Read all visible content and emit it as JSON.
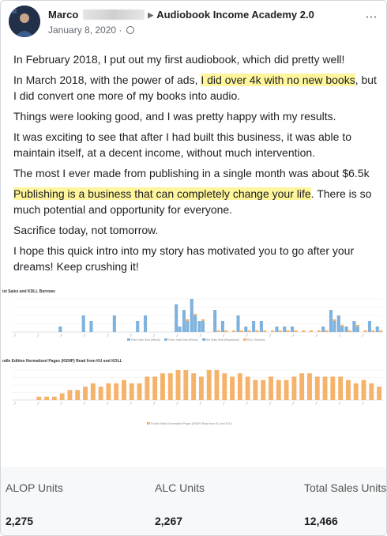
{
  "post": {
    "author": "Marco",
    "group": "Audiobook Income Academy 2.0",
    "date": "January 8, 2020",
    "separator": "·",
    "more_icon": "more-horizontal-icon",
    "privacy_icon": "globe-icon"
  },
  "paragraphs": [
    {
      "text": "In February 2018, I put out my first audiobook, which did pretty well!"
    },
    {
      "pre": "In March 2018, with the power of ads, ",
      "hl": "I did over 4k with no new books",
      "post": ", but I did convert one more of my books into audio."
    },
    {
      "text": "Things were looking good, and I was pretty happy with my results."
    },
    {
      "text": "It was exciting to see that after I had built this business, it was able to maintain itself, at a decent income, without much intervention."
    },
    {
      "text": "The most I ever made from publishing in a single month was about $6.5k"
    },
    {
      "pre": "",
      "hl": "Publishing is a business that can completely change your life",
      "post": ". There is so much potential and opportunity for everyone."
    },
    {
      "text": "Sacrifice today, not tomorrow."
    },
    {
      "text": "I hope this quick intro into my story has motivated you to go after your dreams! Keep crushing it!"
    }
  ],
  "chart_data": [
    {
      "type": "bar",
      "title": "ist Sales and KDLL Borrows",
      "colors": [
        "#7fb2dc",
        "#f4b26b"
      ],
      "series": [
        {
          "name": "Paid Units Sold (eBook)",
          "values": [
            0,
            0,
            0,
            0,
            0,
            0,
            1,
            0,
            0,
            3,
            2,
            0,
            0,
            3,
            0,
            0,
            2,
            3,
            0,
            0,
            0,
            5,
            4,
            6,
            2,
            0,
            4,
            2,
            0,
            3,
            1,
            2,
            2,
            0,
            1,
            1,
            1,
            0,
            0,
            0,
            1,
            4,
            3,
            1,
            2,
            0,
            2,
            1
          ]
        },
        {
          "name": "Free Units Sold (eBook)",
          "values": [
            0,
            0,
            0,
            0,
            0,
            0,
            0,
            0,
            0,
            0,
            0,
            0,
            0,
            0,
            0,
            0,
            0,
            0,
            0,
            0,
            0,
            1,
            1,
            2,
            1,
            0,
            0,
            0,
            0,
            0,
            0,
            0,
            0,
            0,
            0,
            0,
            0,
            0,
            0,
            0,
            0,
            1,
            1,
            0,
            1,
            0,
            0,
            0
          ]
        },
        {
          "name": "Net Units Sold (Paperback)",
          "values": [
            0,
            0,
            0,
            0,
            0,
            0,
            0,
            0,
            0,
            0,
            0,
            0,
            0,
            0,
            0,
            0,
            0,
            0,
            0,
            0,
            0,
            0,
            1,
            1,
            1,
            0,
            0,
            0,
            0,
            0,
            0,
            0,
            0,
            0,
            0,
            0,
            0,
            0,
            0,
            0,
            0,
            1,
            0,
            0,
            0,
            0,
            0,
            0
          ]
        },
        {
          "name": "KDLL Borrows",
          "values": [
            0,
            0,
            0,
            0,
            0,
            0,
            0,
            0,
            0,
            0,
            0,
            0,
            0,
            0,
            0,
            0,
            0,
            0,
            0,
            0,
            0,
            0,
            1,
            1,
            1,
            0,
            1,
            1,
            1,
            1,
            1,
            1,
            1,
            1,
            1,
            1,
            1,
            1,
            1,
            1,
            1,
            1,
            1,
            1,
            1,
            1,
            1,
            1
          ]
        }
      ]
    },
    {
      "type": "bar",
      "title": "ndle Edition Normalized Pages (KENP) Read from KU and KOLL",
      "colors": [
        "#f4b26b"
      ],
      "series": [
        {
          "name": "Kindle Edition Normalized Pages (KENP) Read from KU and KOLL",
          "values": [
            0,
            0,
            0,
            1,
            1,
            1,
            2,
            3,
            3,
            4,
            5,
            4,
            5,
            5,
            6,
            5,
            5,
            7,
            7,
            8,
            8,
            9,
            9,
            8,
            7,
            9,
            9,
            8,
            7,
            8,
            7,
            6,
            6,
            7,
            6,
            6,
            7,
            8,
            8,
            7,
            7,
            7,
            7,
            6,
            5,
            6,
            5,
            4
          ]
        }
      ]
    }
  ],
  "stats": [
    {
      "label": "ALOP Units",
      "value": "2,275"
    },
    {
      "label": "ALC Units",
      "value": "2,267"
    },
    {
      "label": "Total Sales Units",
      "value": "12,466"
    }
  ]
}
